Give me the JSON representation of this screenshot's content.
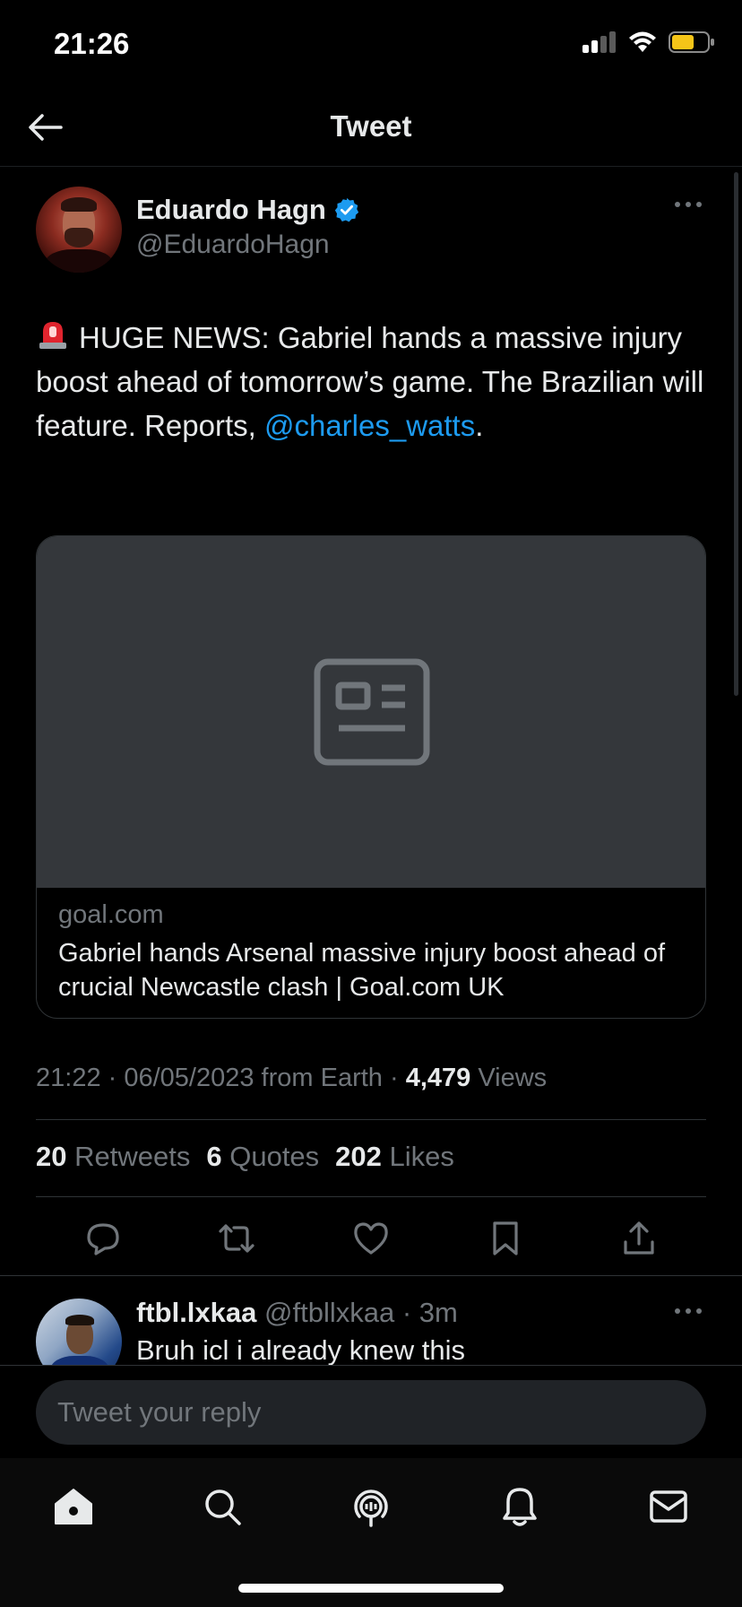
{
  "status_bar": {
    "time": "21:26"
  },
  "header": {
    "title": "Tweet"
  },
  "tweet": {
    "author_name": "Eduardo Hagn",
    "author_handle": "@EduardoHagn",
    "text_main": "HUGE NEWS: Gabriel hands a massive injury boost ahead of tomorrow’s game. The Brazilian will feature. Reports,",
    "mention": "@charles_watts",
    "text_end": ".",
    "card": {
      "domain": "goal.com",
      "title": "Gabriel hands Arsenal massive injury boost ahead of crucial Newcastle clash | Goal.com UK"
    },
    "meta": {
      "timestamp": "21:22 · 06/05/2023 from Earth ·",
      "views_count": "4,479",
      "views_label": "Views"
    },
    "stats": {
      "retweets_count": "20",
      "retweets_label": "Retweets",
      "quotes_count": "6",
      "quotes_label": "Quotes",
      "likes_count": "202",
      "likes_label": "Likes"
    }
  },
  "reply": {
    "name": "ftbl.lxkaa",
    "handle_time": "@ftbllxkaa · 3m",
    "text": "Bruh icl i already knew this"
  },
  "reply_bar": {
    "placeholder": "Tweet your reply"
  },
  "colors": {
    "accent": "#1d9bf0",
    "background": "#000000",
    "secondary_text": "#71767b"
  },
  "icons": [
    "back-arrow-icon",
    "verified-icon",
    "more-icon",
    "siren-icon",
    "article-icon",
    "reply-icon",
    "retweet-icon",
    "like-icon",
    "bookmark-icon",
    "share-icon",
    "home-icon",
    "search-icon",
    "spaces-icon",
    "notifications-icon",
    "messages-icon"
  ]
}
